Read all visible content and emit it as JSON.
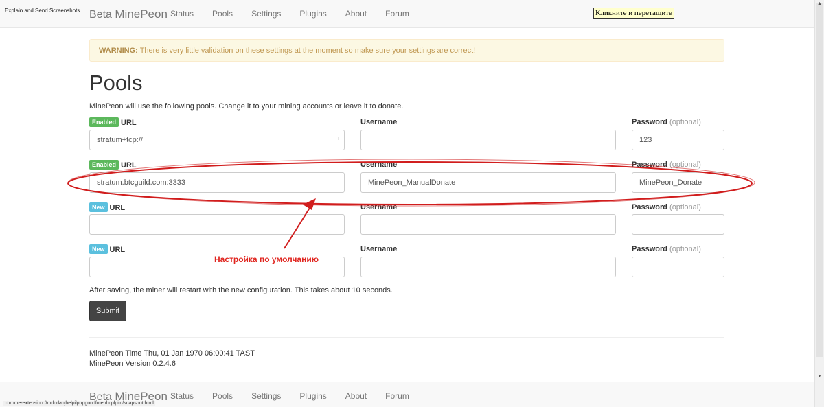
{
  "tool": {
    "explain_label": "Explain and Send Screenshots",
    "drag_tip": "Кликните и перетащите"
  },
  "nav": {
    "brand_prefix": "Beta",
    "brand_name": "MinePeon",
    "links": [
      "Status",
      "Pools",
      "Settings",
      "Plugins",
      "About",
      "Forum"
    ]
  },
  "warning": {
    "title": "WARNING:",
    "text": "There is very little validation on these settings at the moment so make sure your settings are correct!"
  },
  "page": {
    "title": "Pools",
    "intro": "MinePeon will use the following pools. Change it to your mining accounts or leave it to donate."
  },
  "labels": {
    "url": "URL",
    "username": "Username",
    "password": "Password",
    "optional": "(optional)"
  },
  "pools": [
    {
      "status": "Enabled",
      "url": "stratum+tcp://",
      "username": "",
      "password": "123"
    },
    {
      "status": "Enabled",
      "url": "stratum.btcguild.com:3333",
      "username": "MinePeon_ManualDonate",
      "password": "MinePeon_Donate"
    },
    {
      "status": "New",
      "url": "",
      "username": "",
      "password": ""
    },
    {
      "status": "New",
      "url": "",
      "username": "",
      "password": ""
    }
  ],
  "note": "After saving, the miner will restart with the new configuration. This takes about 10 seconds.",
  "submit_label": "Submit",
  "footer": {
    "time": "MinePeon Time Thu, 01 Jan 1970 06:00:41 TAST",
    "version": "MinePeon Version 0.2.4.6"
  },
  "annotation": {
    "text": "Настройка по умолчанию",
    "color": "#e0251f"
  },
  "status_url": "chrome-extension://mdddabjhelpilpnpgondfmehhcplpiin/snapshot.html",
  "colors": {
    "enabled": "#5cb85c",
    "new": "#5bc0de",
    "warning_bg": "#fcf8e3"
  }
}
